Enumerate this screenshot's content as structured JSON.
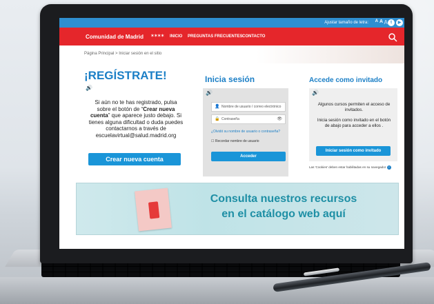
{
  "utility_bar": {
    "font_size_label": "Ajustar tamaño de letra:",
    "font_a1": "A",
    "font_a2": "A",
    "font_a3": "A",
    "social": [
      "twitter-icon",
      "youtube-icon"
    ]
  },
  "nav": {
    "brand": "Comunidad de Madrid",
    "links": [
      "INICIO",
      "PREGUNTAS FRECUENTES",
      "CONTACTO"
    ]
  },
  "breadcrumb": "Página Principal > Iniciar sesión en el sitio",
  "register": {
    "title": "¡REGÍSTRATE!",
    "text_1": "Si aún no te has registrado, pulsa sobre el botón de “",
    "text_bold": "Crear nueva cuenta",
    "text_2": "” que aparece justo debajo. Si tienes alguna dificultad o duda puedes contactarnos a través de escuelavirtual@salud.madrid.org",
    "button": "Crear nueva cuenta"
  },
  "login": {
    "title": "Inicia sesión",
    "username_placeholder": "Nombre de usuario / correo electrónico",
    "password_placeholder": "Contraseña",
    "forgot_link": "¿Olvidó su nombre de usuario o contraseña?",
    "remember_label": "Recordar nombre de usuario",
    "button": "Acceder"
  },
  "guest": {
    "title": "Accede como invitado",
    "p1": "Algunos cursos permiten el acceso de invitados.",
    "p2": "Inicia sesión como invitado en el botón de abajo para acceder a ellos .",
    "button": "Iniciar sesión como invitado",
    "cookies_note": "Las 'Cookies' deben estar habilitadas en su navegador"
  },
  "catalog_banner": {
    "line1": "Consulta nuestros recursos",
    "line2": "en el catálogo web aquí"
  },
  "colors": {
    "nav_red": "#e5262b",
    "util_blue": "#2f8fd1",
    "title_blue": "#1b7fc6",
    "button_blue": "#1a95d8"
  }
}
